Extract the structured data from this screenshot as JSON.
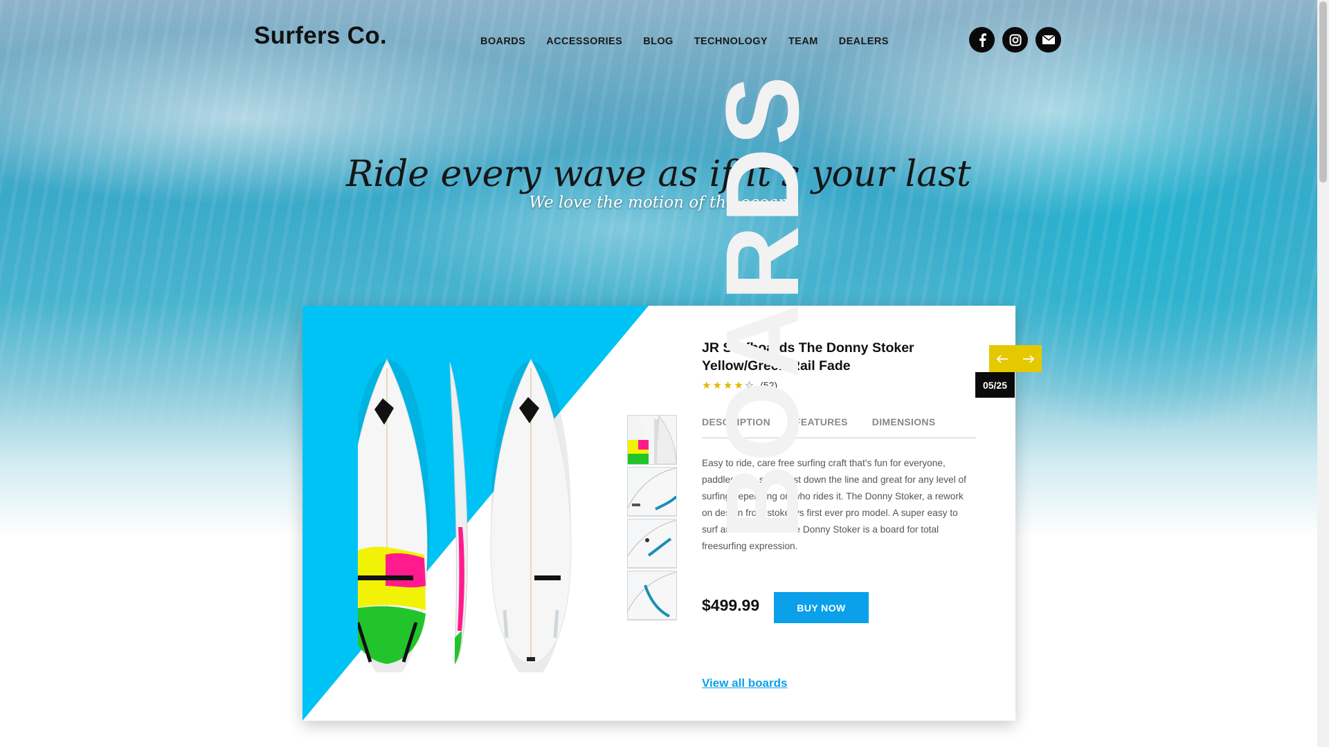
{
  "header": {
    "logo": "Surfers Co.",
    "nav": [
      "BOARDS",
      "ACCESSORIES",
      "BLOG",
      "TECHNOLOGY",
      "TEAM",
      "DEALERS"
    ],
    "social_icons": [
      "facebook-icon",
      "instagram-icon",
      "email-icon"
    ]
  },
  "hero": {
    "tagline": "Ride every wave as if it's your last",
    "subline": "We love the motion of the ocean"
  },
  "product": {
    "title": "JR Surfboards The Donny Stoker Yellow/Green Rail Fade",
    "rating": 4,
    "rating_max": 5,
    "review_count": "(52)",
    "tabs": [
      "DESCRIPTION",
      "FEATURES",
      "DIMENSIONS"
    ],
    "description": "Easy to ride, care free surfing craft that's fun for everyone, paddles well, super fast down the line and great for any level of surfing depending on who rides it. The Donny Stoker, a rework on design from stokesys first ever pro model. A super easy to surf and fun board. The Donny Stoker is a board for total freesurfing expression.",
    "price": "$499.99",
    "buy_label": "BUY NOW",
    "view_all_label": "View all boards",
    "watermark": "BOARDS",
    "counter": "05/25",
    "thumbnail_count": 4
  },
  "colors": {
    "accent": "#0aa0ea",
    "diagonal": "#00c3f5",
    "arrow_bg": "#e6c800"
  }
}
